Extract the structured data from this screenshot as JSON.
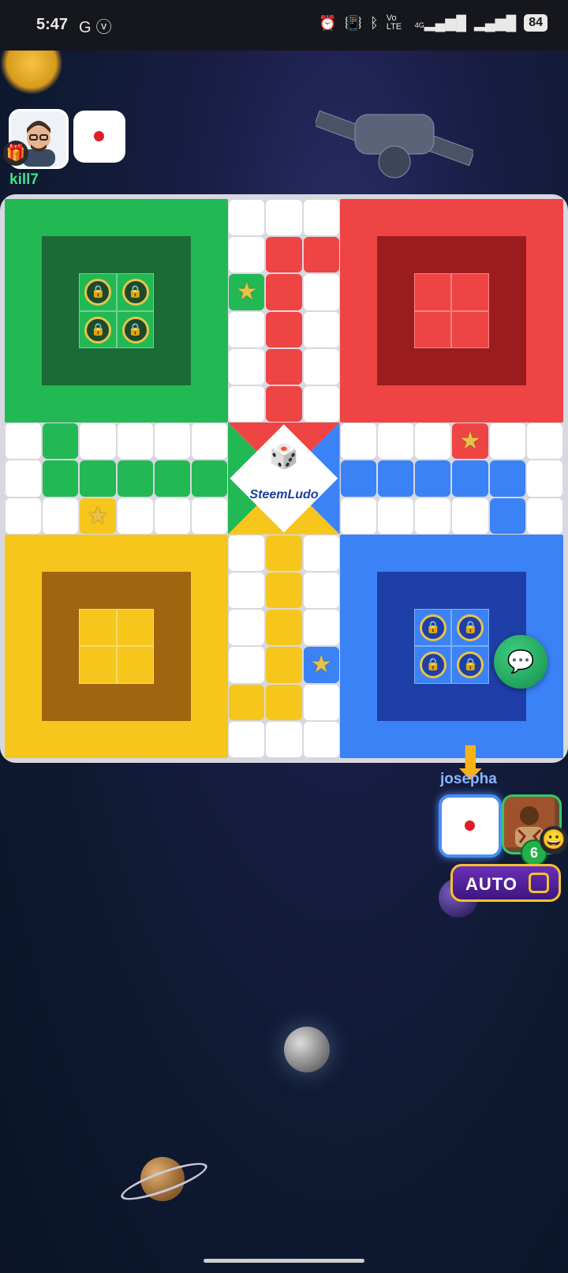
{
  "status_bar": {
    "time": "5:47",
    "left_icons": [
      "google-icon",
      "v-icon"
    ],
    "right_icons": [
      "alarm-icon",
      "vibrate-icon",
      "bluetooth-icon",
      "volte-icon",
      "signal-4g-icon",
      "signal-icon"
    ],
    "volte_label": "Vo LTE",
    "network_label": "4G",
    "battery": "84"
  },
  "top_player": {
    "name": "kill7",
    "color": "green",
    "dice_face": 1,
    "gift_icon": "gift-icon"
  },
  "bottom_player": {
    "name": "josepha",
    "color": "blue",
    "dice_face": 1,
    "level": "6",
    "emoji_icon": "smile-icon",
    "turn_indicator_icon": "arrow-down-icon"
  },
  "board": {
    "center_logo": "SteemLudo",
    "colors": {
      "green": "#22b954",
      "green_dark": "#1b6b36",
      "red": "#ef4444",
      "red_dark": "#9b1c1f",
      "yellow": "#f7c61c",
      "yellow_dark": "#a0650f",
      "blue": "#3b82f6",
      "blue_dark": "#1e3fa8",
      "track": "#ffffff"
    },
    "green_home_tokens": 4,
    "blue_home_tokens": 4,
    "red_home_tokens": 0,
    "yellow_home_tokens": 0
  },
  "controls": {
    "chat_icon": "chat-icon",
    "auto_label": "AUTO",
    "auto_enabled": false
  }
}
